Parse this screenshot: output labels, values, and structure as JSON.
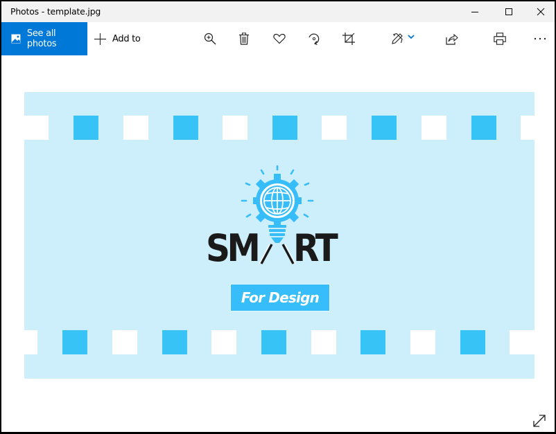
{
  "window": {
    "title": "Photos - template.jpg",
    "controls": [
      "minimize",
      "maximize",
      "close"
    ]
  },
  "toolbar": {
    "see_all_photos_label": "See all photos",
    "add_to_label": "Add to",
    "tools": [
      {
        "name": "zoom-in",
        "icon": "zoom-in-icon"
      },
      {
        "name": "delete",
        "icon": "trash-icon"
      },
      {
        "name": "favorite",
        "icon": "heart-icon"
      },
      {
        "name": "rotate",
        "icon": "rotate-icon"
      },
      {
        "name": "crop",
        "icon": "crop-icon"
      },
      {
        "name": "edit-create",
        "icon": "edit-pencil-icon"
      },
      {
        "name": "share",
        "icon": "share-icon"
      },
      {
        "name": "print",
        "icon": "print-icon"
      },
      {
        "name": "more",
        "icon": "more-icon"
      }
    ],
    "accent_color": "#0078d7"
  },
  "image": {
    "filename": "template.jpg",
    "logo_text_left": "SM",
    "logo_text_right": "RT",
    "tagline": "For Design",
    "colors": {
      "background": "#cdeefb",
      "accent_blue": "#37c3f6",
      "text_dark": "#1a1a1a"
    }
  },
  "footer": {
    "expand_icon": "expand-icon"
  }
}
